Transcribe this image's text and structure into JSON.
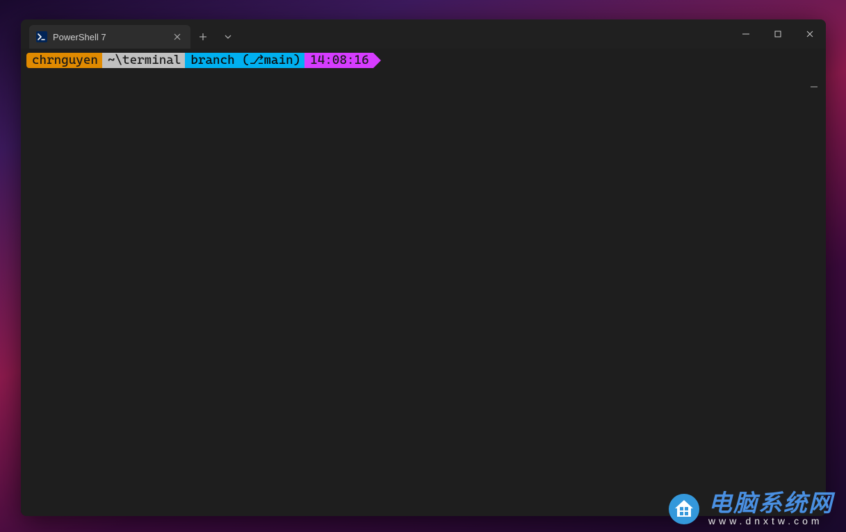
{
  "tab": {
    "title": "PowerShell 7",
    "icon": "powershell-icon"
  },
  "titlebar": {
    "new_tab_tooltip": "New Tab",
    "dropdown_tooltip": "Open a new tab dropdown"
  },
  "window_controls": {
    "minimize": "Minimize",
    "maximize": "Maximize",
    "close": "Close"
  },
  "prompt": {
    "user": "chrnguyen",
    "path": "~\\terminal",
    "branch": "branch (⎇main)",
    "time": "14:08:16"
  },
  "watermark": {
    "cn": "电脑系统网",
    "url": "www.dnxtw.com"
  }
}
